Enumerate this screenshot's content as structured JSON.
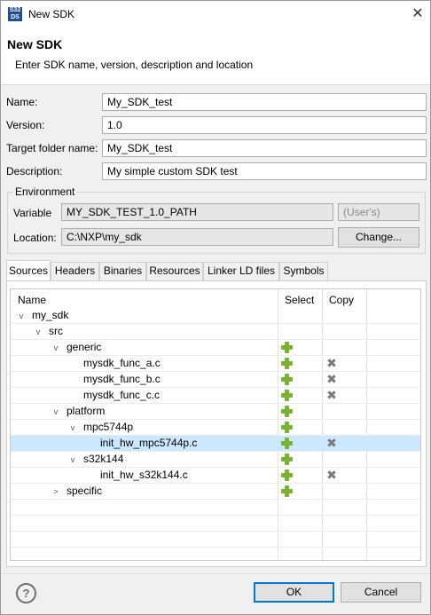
{
  "window": {
    "title": "New SDK",
    "app_icon": "S32 DS",
    "close_glyph": "✕"
  },
  "header": {
    "title": "New SDK",
    "subtitle": "Enter SDK name, version, description and location"
  },
  "form": {
    "name_label": "Name:",
    "name_value": "My_SDK_test",
    "version_label": "Version:",
    "version_value": "1.0",
    "target_label": "Target folder name:",
    "target_value": "My_SDK_test",
    "description_label": "Description:",
    "description_value": "My simple custom SDK test"
  },
  "environment": {
    "title": "Environment",
    "variable_label": "Variable",
    "variable_value": "MY_SDK_TEST_1.0_PATH",
    "variable_scope": "(User's)",
    "location_label": "Location:",
    "location_value": "C:\\NXP\\my_sdk",
    "change_button": "Change..."
  },
  "tabs": [
    "Sources",
    "Headers",
    "Binaries",
    "Resources",
    "Linker LD files",
    "Symbols"
  ],
  "tree": {
    "columns": [
      "Name",
      "Select",
      "Copy"
    ],
    "rows": [
      {
        "label": "my_sdk",
        "expander": "v",
        "select": false,
        "copy": false
      },
      {
        "label": "src",
        "expander": "v",
        "select": false,
        "copy": false
      },
      {
        "label": "generic",
        "expander": "v",
        "select": true,
        "copy": false
      },
      {
        "label": "mysdk_func_a.c",
        "expander": "",
        "select": true,
        "copy": true
      },
      {
        "label": "mysdk_func_b.c",
        "expander": "",
        "select": true,
        "copy": true
      },
      {
        "label": "mysdk_func_c.c",
        "expander": "",
        "select": true,
        "copy": true
      },
      {
        "label": "platform",
        "expander": "v",
        "select": true,
        "copy": false
      },
      {
        "label": "mpc5744p",
        "expander": "v",
        "select": true,
        "copy": false
      },
      {
        "label": "init_hw_mpc5744p.c",
        "expander": "",
        "select": true,
        "copy": true,
        "selected": true
      },
      {
        "label": "s32k144",
        "expander": "v",
        "select": true,
        "copy": false
      },
      {
        "label": "init_hw_s32k144.c",
        "expander": "",
        "select": true,
        "copy": true
      },
      {
        "label": "specific",
        "expander": ">",
        "select": true,
        "copy": false
      }
    ]
  },
  "footer": {
    "help_glyph": "?",
    "ok_button": "OK",
    "cancel_button": "Cancel"
  },
  "colors": {
    "selection": "#cce8ff",
    "add_icon": "#78b332",
    "remove_icon": "#7a7a7a",
    "default_button_border": "#0078d7"
  }
}
